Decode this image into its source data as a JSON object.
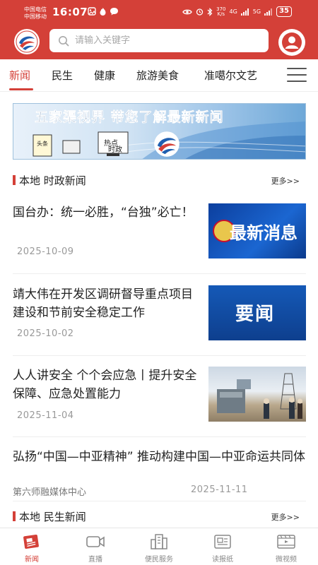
{
  "status_bar": {
    "carrier1": "中国电信",
    "carrier2": "中国移动",
    "time": "16:07",
    "speed_value": "370",
    "speed_unit": "K/s",
    "net1": "4G",
    "net2": "5G",
    "battery": "35"
  },
  "header": {
    "search_placeholder": "请输入关键字"
  },
  "nav": {
    "tabs": [
      {
        "label": "新闻",
        "active": true
      },
      {
        "label": "民生",
        "active": false
      },
      {
        "label": "健康",
        "active": false
      },
      {
        "label": "旅游美食",
        "active": false
      },
      {
        "label": "准噶尔文艺",
        "active": false
      }
    ]
  },
  "banner": {
    "text": "五家渠视界 带您了解最新新闻",
    "tags": [
      "头条",
      "热点",
      "时政"
    ]
  },
  "sections": [
    {
      "title": "本地  时政新闻",
      "more": "更多>>"
    },
    {
      "title": "本地  民生新闻",
      "more": "更多>>"
    }
  ],
  "news": [
    {
      "title": "国台办：统一必胜，“台独”必亡！",
      "date": "2025-10-09",
      "thumb_text": "最新消息"
    },
    {
      "title": "靖大伟在开发区调研督导重点项目建设和节前安全稳定工作",
      "date": "2025-10-02",
      "thumb_text": "要闻"
    },
    {
      "title": "人人讲安全  个个会应急丨提升安全保障、应急处置能力",
      "date": "2025-11-04",
      "thumb_text": ""
    },
    {
      "title": "弘扬“中国—中亚精神”  推动构建中国—中亚命运共同体",
      "source": "第六师融媒体中心",
      "date": "2025-11-11"
    }
  ],
  "bottom_tabs": [
    {
      "label": "新闻",
      "icon": "newspaper-icon",
      "active": true
    },
    {
      "label": "直播",
      "icon": "video-camera-icon",
      "active": false
    },
    {
      "label": "便民服务",
      "icon": "buildings-icon",
      "active": false
    },
    {
      "label": "读报纸",
      "icon": "paper-reader-icon",
      "active": false
    },
    {
      "label": "微视频",
      "icon": "film-icon",
      "active": false
    }
  ],
  "colors": {
    "brand": "#d44038",
    "muted": "#999999"
  }
}
